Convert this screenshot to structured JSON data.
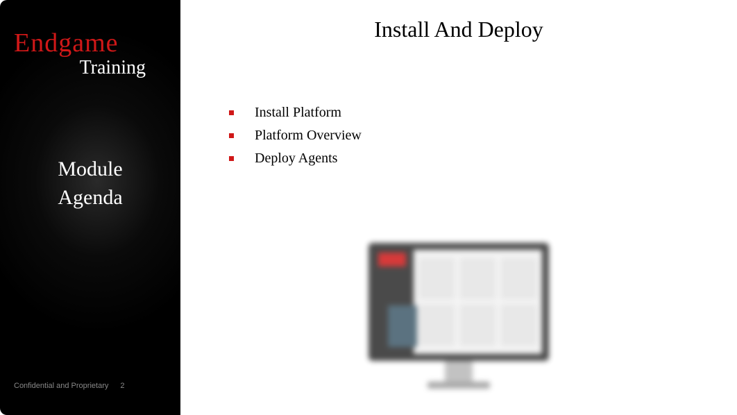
{
  "sidebar": {
    "brand": "Endgame",
    "subbrand": "Training",
    "module_line1": "Module",
    "module_line2": "Agenda",
    "footer_text": "Confidential and Proprietary",
    "page_number": "2"
  },
  "main": {
    "title": "Install And Deploy",
    "bullets": [
      "Install Platform",
      "Platform Overview",
      "Deploy Agents"
    ]
  },
  "colors": {
    "accent_red": "#d01818",
    "sidebar_bg": "#000000",
    "text_light": "#ffffff"
  }
}
